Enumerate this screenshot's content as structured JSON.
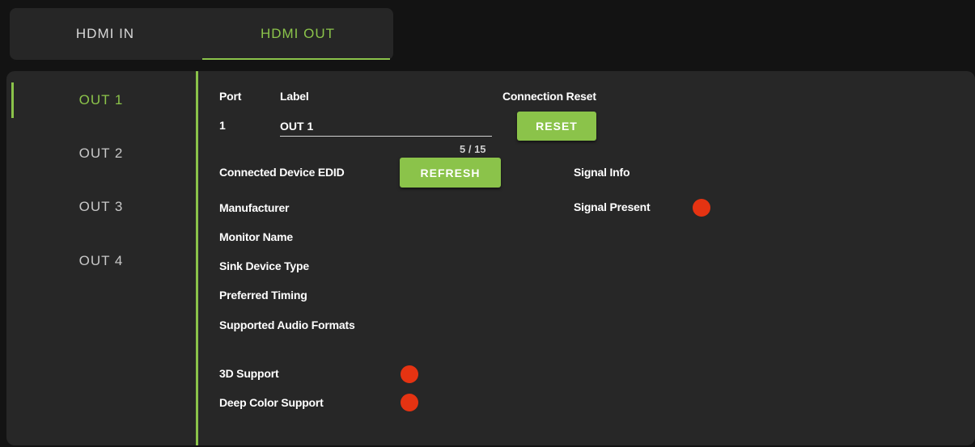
{
  "tabs": [
    {
      "label": "HDMI IN",
      "active": false
    },
    {
      "label": "HDMI OUT",
      "active": true
    }
  ],
  "sidebar": {
    "items": [
      {
        "label": "OUT 1",
        "active": true
      },
      {
        "label": "OUT 2",
        "active": false
      },
      {
        "label": "OUT 3",
        "active": false
      },
      {
        "label": "OUT 4",
        "active": false
      }
    ]
  },
  "details": {
    "port_header": "Port",
    "label_header": "Label",
    "port_value": "1",
    "label_value": "OUT 1",
    "label_counter": "5 / 15",
    "connection_reset_header": "Connection Reset",
    "reset_button": "RESET",
    "edid_header": "Connected Device EDID",
    "refresh_button": "REFRESH",
    "manufacturer": "Manufacturer",
    "monitor_name": "Monitor Name",
    "sink_device_type": "Sink Device Type",
    "preferred_timing": "Preferred Timing",
    "supported_audio_formats": "Supported Audio Formats",
    "support_3d": "3D Support",
    "deep_color_support": "Deep Color Support",
    "signal_info": "Signal Info",
    "signal_present": "Signal Present"
  },
  "status": {
    "support_3d": "off",
    "deep_color_support": "off",
    "signal_present": "off",
    "indicator_off_color": "#e53312",
    "accent_color": "#8bc34a"
  }
}
